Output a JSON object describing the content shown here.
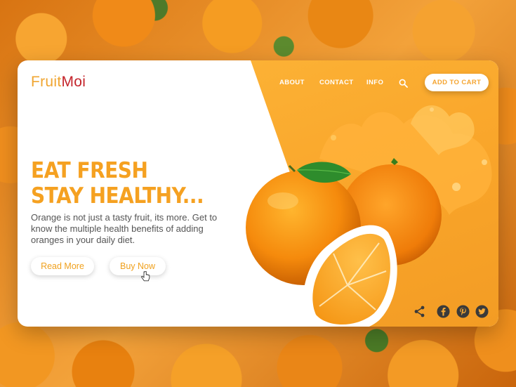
{
  "logo": {
    "part1": "Fruit",
    "part2": "Moi"
  },
  "nav": {
    "about": "ABOUT",
    "contact": "CONTACT",
    "info": "INFO",
    "add_to_cart": "ADD TO CART"
  },
  "hero": {
    "headline_line1": "EAT FRESH",
    "headline_line2": "STAY HEALTHY...",
    "description": "Orange is not just a tasty fruit, its more. Get to know the multiple health benefits of adding oranges in your daily diet.",
    "read_more": "Read More",
    "buy_now": "Buy Now"
  },
  "icons": [
    "search-icon",
    "cursor-icon",
    "share-icon",
    "facebook-icon",
    "pinterest-icon",
    "twitter-icon"
  ],
  "colors": {
    "accent": "#f5a121",
    "panel": "#fbad36",
    "logo_red": "#c4242b",
    "social": "#3a3a3a"
  }
}
